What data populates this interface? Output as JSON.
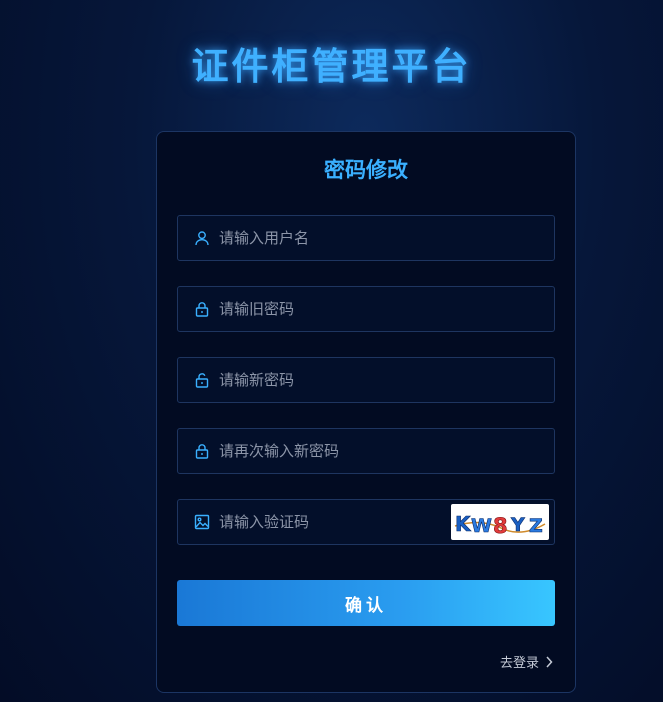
{
  "app": {
    "title": "证件柜管理平台"
  },
  "form": {
    "title": "密码修改",
    "username": {
      "placeholder": "请输入用户名",
      "icon": "user-icon"
    },
    "old_password": {
      "placeholder": "请输旧密码",
      "icon": "lock-icon"
    },
    "new_password": {
      "placeholder": "请输新密码",
      "icon": "unlock-icon"
    },
    "confirm_password": {
      "placeholder": "请再次输入新密码",
      "icon": "lock-icon"
    },
    "captcha": {
      "placeholder": "请输入验证码",
      "icon": "image-icon",
      "code": "KW8YZ"
    },
    "submit_label": "确认",
    "login_link": "去登录"
  },
  "colors": {
    "accent": "#3ab0ff",
    "background": "#030c26",
    "card": "#020b22",
    "button_start": "#1a78d6",
    "button_end": "#38c6ff"
  }
}
